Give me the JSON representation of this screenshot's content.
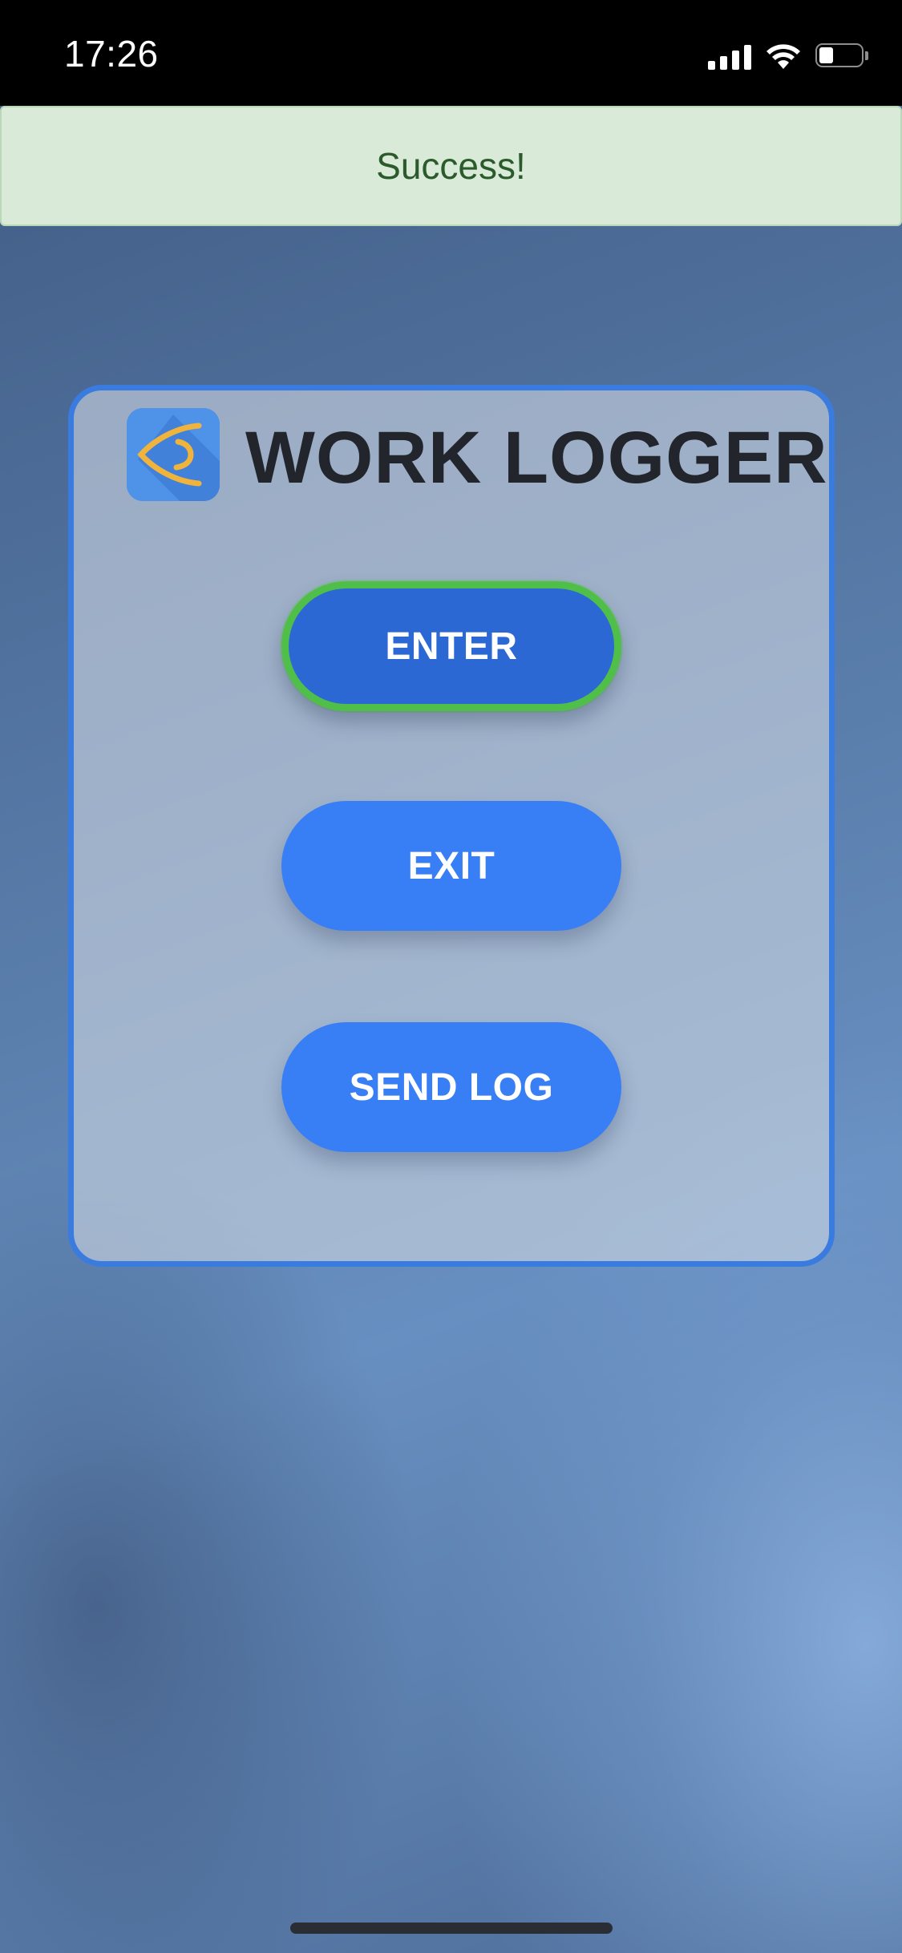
{
  "status_bar": {
    "time": "17:26",
    "icons": [
      "cellular-signal-icon",
      "wifi-icon",
      "battery-icon"
    ]
  },
  "toast": {
    "message": "Success!",
    "colors": {
      "background": "#d9ead9",
      "text": "#2b5a2b"
    }
  },
  "app": {
    "title": "WORK LOGGER",
    "logo_icon": "eye-icon",
    "accent_color": "#387ef5",
    "panel_border_color": "#3a7be0"
  },
  "buttons": {
    "enter": {
      "label": "ENTER",
      "state": "focused",
      "focus_ring_color": "#4fbf49"
    },
    "exit": {
      "label": "EXIT"
    },
    "send_log": {
      "label": "SEND LOG"
    }
  }
}
